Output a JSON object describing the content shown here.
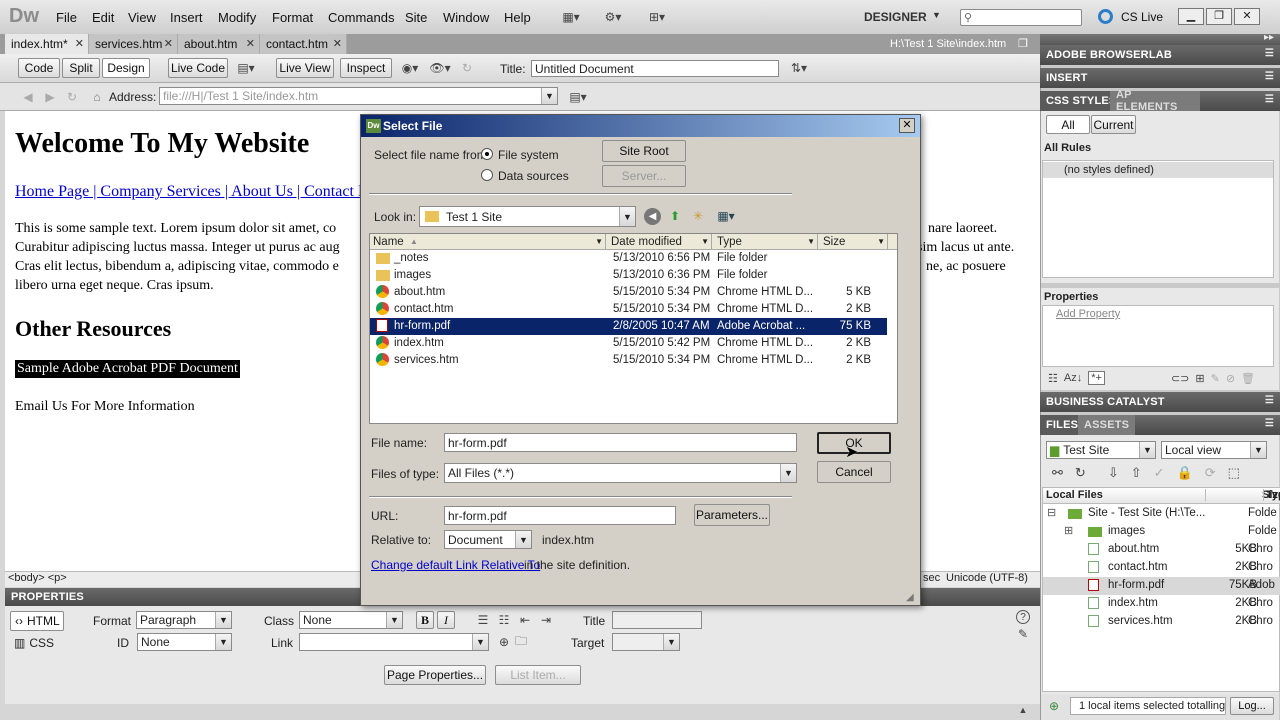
{
  "app": {
    "logo": "Dw",
    "workspace": "DESIGNER",
    "cs_live": "CS Live"
  },
  "menu": [
    "File",
    "Edit",
    "View",
    "Insert",
    "Modify",
    "Format",
    "Commands",
    "Site",
    "Window",
    "Help"
  ],
  "doc_tabs": [
    {
      "label": "index.htm*"
    },
    {
      "label": "services.htm"
    },
    {
      "label": "about.htm"
    },
    {
      "label": "contact.htm"
    }
  ],
  "doc_path": "H:\\Test 1 Site\\index.htm",
  "doc_toolbar": {
    "code": "Code",
    "split": "Split",
    "design": "Design",
    "live_code": "Live Code",
    "live_view": "Live View",
    "inspect": "Inspect",
    "title_label": "Title:",
    "title_value": "Untitled Document"
  },
  "address": {
    "label": "Address:",
    "value": "file:///H|/Test 1 Site/index.htm"
  },
  "page": {
    "heading": "Welcome To My Website",
    "nav": "Home Page | Company Services | About Us | Contact Info",
    "para1_left": "This is some sample text. Lorem ipsum dolor sit amet, co",
    "para1_right": "nare laoreet.",
    "para2_left": "Curabitur adipiscing luctus massa. Integer ut purus ac aug",
    "para2_right": "sim lacus ut ante.",
    "para3_left": "Cras elit lectus, bibendum a, adipiscing vitae, commodo e",
    "para3_right": "ne, ac posuere",
    "para4": "libero urna eget neque. Cras ipsum.",
    "heading2": "Other Resources",
    "pdf_link": "Sample Adobe Acrobat PDF Document",
    "email": "Email Us For More Information"
  },
  "status": {
    "tags": "<body> <p>",
    "encoding": "Unicode (UTF-8)",
    "sec": "sec"
  },
  "properties": {
    "title": "PROPERTIES",
    "html": "HTML",
    "css": "CSS",
    "format_label": "Format",
    "format_value": "Paragraph",
    "class_label": "Class",
    "class_value": "None",
    "id_label": "ID",
    "id_value": "None",
    "link_label": "Link",
    "title_label": "Title",
    "target_label": "Target",
    "page_props": "Page Properties...",
    "list_item": "List Item..."
  },
  "dialog": {
    "title": "Select File",
    "select_from": "Select file name from:",
    "opt_fs": "File system",
    "opt_ds": "Data sources",
    "site_root": "Site Root",
    "server": "Server...",
    "look_in_label": "Look in:",
    "look_in_value": "Test 1 Site",
    "columns": [
      "Name",
      "Date modified",
      "Type",
      "Size"
    ],
    "files": [
      {
        "name": "_notes",
        "date": "5/13/2010 6:56 PM",
        "type": "File folder",
        "size": "",
        "kind": "folder"
      },
      {
        "name": "images",
        "date": "5/13/2010 6:36 PM",
        "type": "File folder",
        "size": "",
        "kind": "folder"
      },
      {
        "name": "about.htm",
        "date": "5/15/2010 5:34 PM",
        "type": "Chrome HTML D...",
        "size": "5 KB",
        "kind": "chrome"
      },
      {
        "name": "contact.htm",
        "date": "5/15/2010 5:34 PM",
        "type": "Chrome HTML D...",
        "size": "2 KB",
        "kind": "chrome"
      },
      {
        "name": "hr-form.pdf",
        "date": "2/8/2005 10:47 AM",
        "type": "Adobe Acrobat ...",
        "size": "75 KB",
        "kind": "pdf",
        "selected": true
      },
      {
        "name": "index.htm",
        "date": "5/15/2010 5:42 PM",
        "type": "Chrome HTML D...",
        "size": "2 KB",
        "kind": "chrome"
      },
      {
        "name": "services.htm",
        "date": "5/15/2010 5:34 PM",
        "type": "Chrome HTML D...",
        "size": "2 KB",
        "kind": "chrome"
      }
    ],
    "file_name_label": "File name:",
    "file_name_value": "hr-form.pdf",
    "file_type_label": "Files of type:",
    "file_type_value": "All Files (*.*)",
    "ok": "OK",
    "cancel": "Cancel",
    "url_label": "URL:",
    "url_value": "hr-form.pdf",
    "params": "Parameters...",
    "relative_label": "Relative to:",
    "relative_value": "Document",
    "relative_file": "index.htm",
    "change_link": "Change default Link Relative To",
    "change_suffix": " in the site definition."
  },
  "right": {
    "browserlab": "ADOBE BROWSERLAB",
    "insert": "INSERT",
    "css_styles": "CSS STYLES",
    "ap_elements": "AP ELEMENTS",
    "all": "All",
    "current": "Current",
    "all_rules": "All Rules",
    "no_styles": "(no styles defined)",
    "properties": "Properties",
    "add_property": "Add Property",
    "business_catalyst": "BUSINESS CATALYST",
    "files_tab": "FILES",
    "assets_tab": "ASSETS",
    "site_value": "Test Site",
    "view_value": "Local view",
    "local_files": "Local Files",
    "size_col": "Size",
    "type_col": "Typ",
    "tree": [
      {
        "name": "Site - Test Site (H:\\Te...",
        "size": "",
        "type": "Folde",
        "level": 0,
        "kind": "site"
      },
      {
        "name": "images",
        "size": "",
        "type": "Folde",
        "level": 1,
        "kind": "folder"
      },
      {
        "name": "about.htm",
        "size": "5KB",
        "type": "Chro",
        "level": 1,
        "kind": "file"
      },
      {
        "name": "contact.htm",
        "size": "2KB",
        "type": "Chro",
        "level": 1,
        "kind": "file"
      },
      {
        "name": "hr-form.pdf",
        "size": "75KB",
        "type": "Adob",
        "level": 1,
        "kind": "pdf",
        "selected": true
      },
      {
        "name": "index.htm",
        "size": "2KB",
        "type": "Chro",
        "level": 1,
        "kind": "file"
      },
      {
        "name": "services.htm",
        "size": "2KB",
        "type": "Chro",
        "level": 1,
        "kind": "file"
      }
    ],
    "status": "1 local items selected totalling",
    "log": "Log..."
  }
}
